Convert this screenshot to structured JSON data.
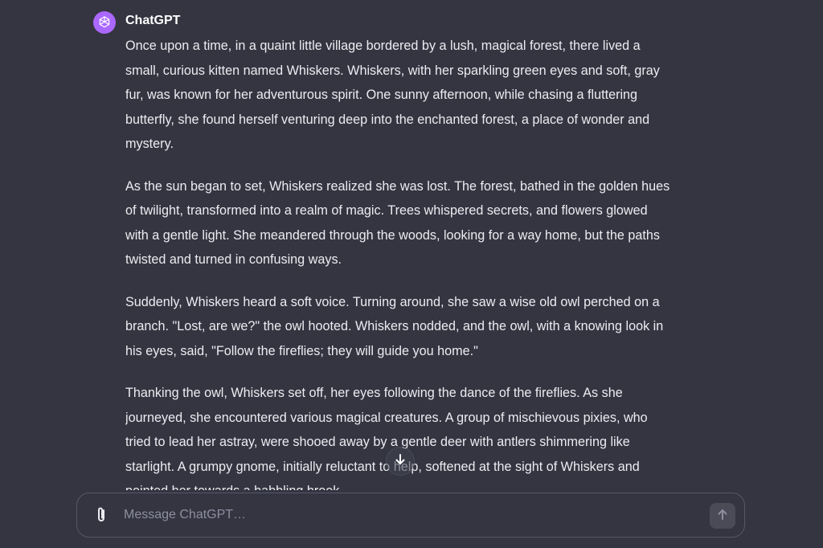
{
  "message": {
    "author": "ChatGPT",
    "avatar_icon": "openai-logo-icon",
    "paragraphs": [
      "Once upon a time, in a quaint little village bordered by a lush, magical forest, there lived a small, curious kitten named Whiskers. Whiskers, with her sparkling green eyes and soft, gray fur, was known for her adventurous spirit. One sunny afternoon, while chasing a fluttering butterfly, she found herself venturing deep into the enchanted forest, a place of wonder and mystery.",
      "As the sun began to set, Whiskers realized she was lost. The forest, bathed in the golden hues of twilight, transformed into a realm of magic. Trees whispered secrets, and flowers glowed with a gentle light. She meandered through the woods, looking for a way home, but the paths twisted and turned in confusing ways.",
      "Suddenly, Whiskers heard a soft voice. Turning around, she saw a wise old owl perched on a branch. \"Lost, are we?\" the owl hooted. Whiskers nodded, and the owl, with a knowing look in his eyes, said, \"Follow the fireflies; they will guide you home.\"",
      "Thanking the owl, Whiskers set off, her eyes following the dance of the fireflies. As she journeyed, she encountered various magical creatures. A group of mischievous pixies, who tried to lead her astray, were shooed away by a gentle deer with antlers shimmering like starlight. A grumpy gnome, initially reluctant to help, softened at the sight of Whiskers and pointed her towards a babbling brook."
    ]
  },
  "composer": {
    "placeholder": "Message ChatGPT…",
    "value": "",
    "attach_icon": "paperclip-icon",
    "send_icon": "arrow-up-icon"
  },
  "scroll_button": {
    "icon": "arrow-down-icon"
  },
  "colors": {
    "background": "#343541",
    "text": "#ececf1",
    "avatar": "#ab68ff",
    "border": "#565869",
    "placeholder": "#8e8ea0"
  }
}
